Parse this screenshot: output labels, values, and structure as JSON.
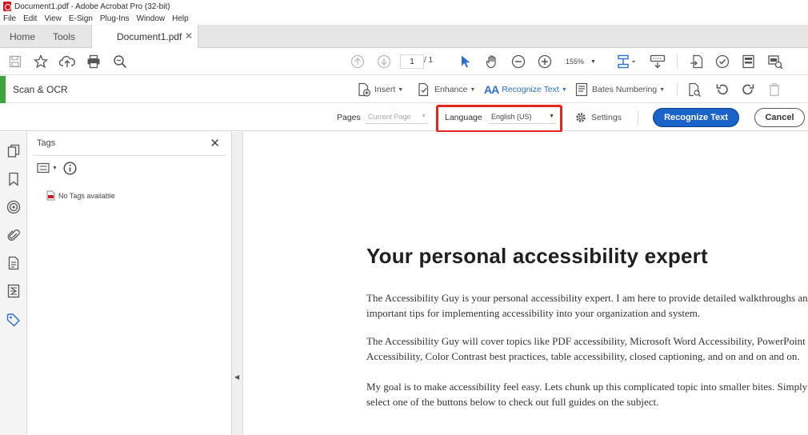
{
  "window": {
    "title": "Document1.pdf - Adobe Acrobat Pro (32-bit)"
  },
  "menu": [
    "File",
    "Edit",
    "View",
    "E-Sign",
    "Plug-Ins",
    "Window",
    "Help"
  ],
  "tabs": {
    "home": "Home",
    "tools": "Tools",
    "document": "Document1.pdf",
    "close": "✕"
  },
  "toolbar": {
    "page_current": "1",
    "page_total": "/ 1",
    "zoom": "155%"
  },
  "scan_toolbar": {
    "title": "Scan & OCR",
    "insert": "Insert",
    "enhance": "Enhance",
    "recognize_text": "Recognize Text",
    "bates_numbering": "Bates Numbering"
  },
  "recognize_options": {
    "pages_label": "Pages",
    "pages_value": "Current Page",
    "language_label": "Language",
    "language_value": "English (US)",
    "settings": "Settings",
    "recognize_button": "Recognize Text",
    "cancel_button": "Cancel"
  },
  "tags_panel": {
    "title": "Tags",
    "close": "✕",
    "empty_message": "No Tags available"
  },
  "document": {
    "heading": "Your personal accessibility expert",
    "paragraphs": [
      "The Accessibility Guy is your personal accessibility expert. I am here to provide detailed walkthroughs and important tips for implementing accessibility into your organization and system.",
      "The Accessibility Guy will cover topics like PDF accessibility, Microsoft Word Accessibility, PowerPoint Accessibility, Color Contrast best practices, table accessibility, closed captioning, and on and on and on.",
      "My goal is to make accessibility feel easy. Lets chunk up this complicated topic into smaller bites. Simply select one of the buttons below to check out full guides on the subject."
    ]
  },
  "colors": {
    "accent_blue": "#1a63c9",
    "scan_green": "#3fa440",
    "highlight_red": "#e5271c",
    "pdf_red": "#d0181f"
  }
}
